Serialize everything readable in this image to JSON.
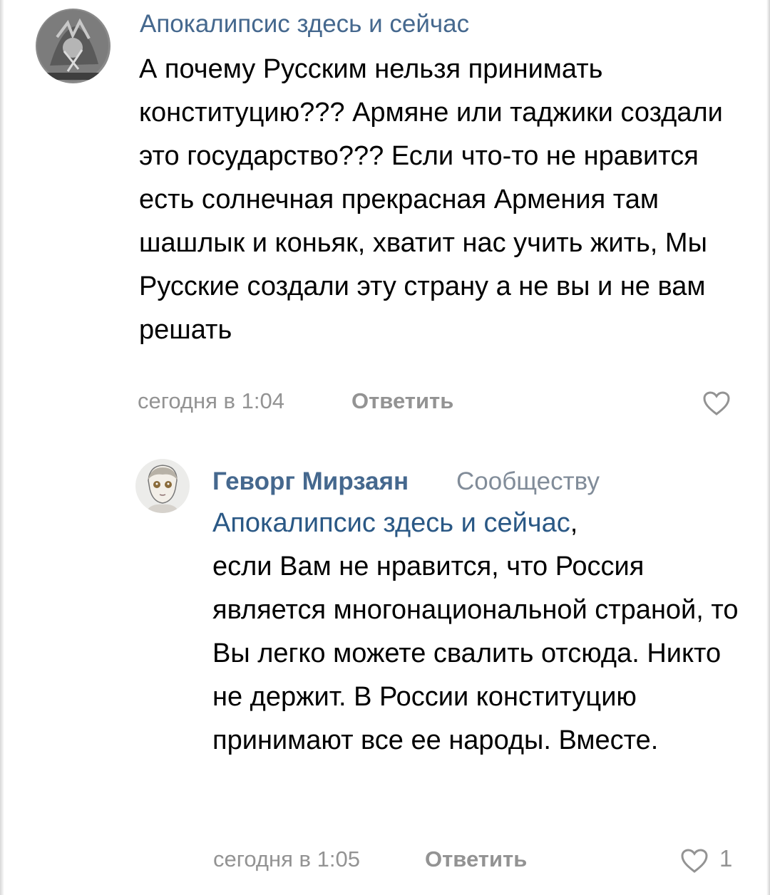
{
  "comments": [
    {
      "author": "Апокалипсис здесь и сейчас",
      "text": "А почему Русским нельзя принимать конституцию??? Армяне или таджики создали это государство??? Если что-то не нравится есть солнечная прекрасная Армения там шашлык и коньяк, хватит нас учить жить, Мы Русские создали эту страну а не вы и не вам решать",
      "time": "сегодня в 1:04",
      "reply_label": "Ответить",
      "like_icon": "heart-outline-icon"
    },
    {
      "author": "Геворг Мирзаян",
      "to_label": "Сообществу",
      "mention": "Апокалипсис здесь и сейчас",
      "mention_suffix": ",",
      "text": "если Вам не нравится, что Россия является многонациональной страной, то Вы легко можете свалить отсюда. Никто не держит. В России конституцию принимают все ее народы. Вместе.",
      "time": "сегодня в 1:05",
      "reply_label": "Ответить",
      "like_icon": "heart-outline-icon",
      "likes": "1"
    }
  ],
  "colors": {
    "author_link": "#45688e",
    "mention_link": "#2a5885",
    "meta_gray": "#939393",
    "body_text": "#000000"
  }
}
